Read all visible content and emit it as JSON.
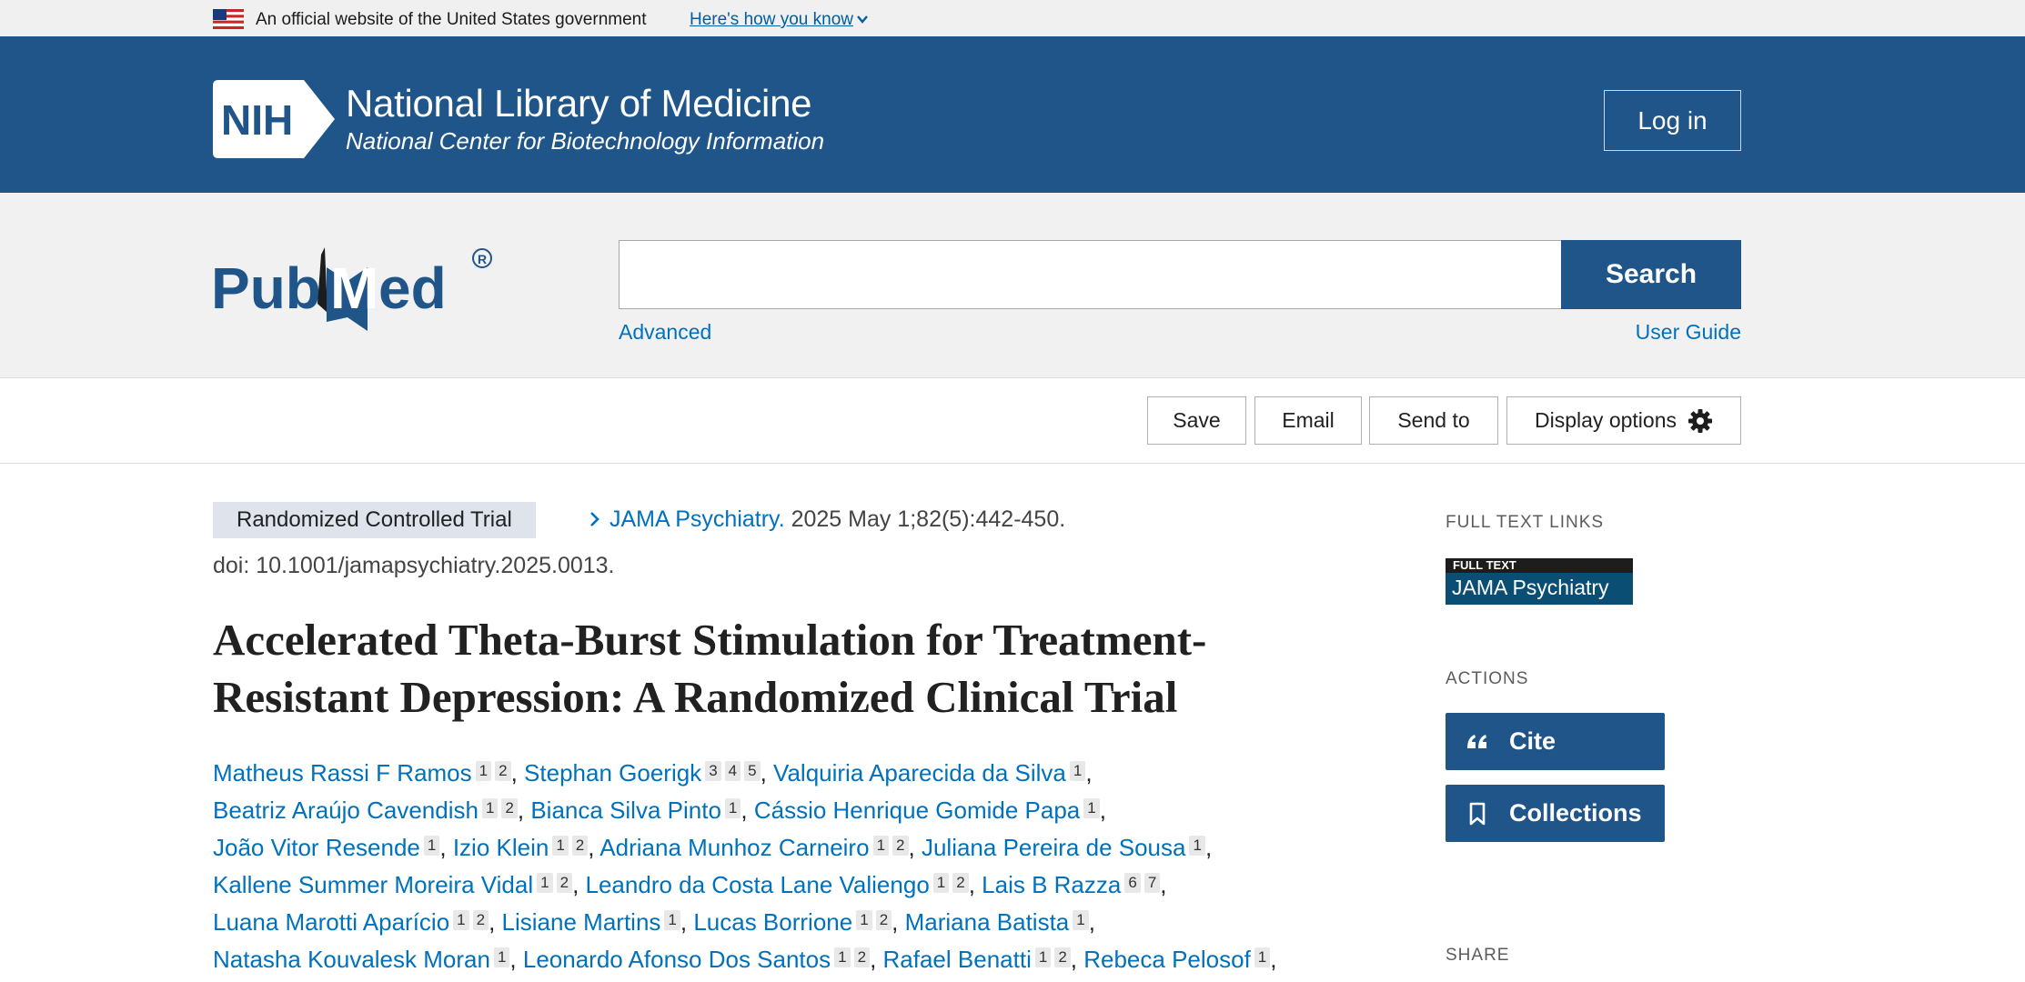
{
  "gov_banner": {
    "text": "An official website of the United States government",
    "link": "Here's how you know"
  },
  "nih": {
    "logo_text": "NIH",
    "title": "National Library of Medicine",
    "subtitle": "National Center for Biotechnology Information",
    "login_label": "Log in"
  },
  "search": {
    "logo_alt": "PubMed",
    "query": "",
    "button_label": "Search",
    "advanced_label": "Advanced",
    "user_guide_label": "User Guide"
  },
  "toolbar": {
    "save": "Save",
    "email": "Email",
    "send_to": "Send to",
    "display_options": "Display options"
  },
  "article": {
    "pub_type": "Randomized Controlled Trial",
    "journal": "JAMA Psychiatry.",
    "citation": " 2025 May 1;82(5):442-450.",
    "doi": "doi: 10.1001/jamapsychiatry.2025.0013.",
    "title": "Accelerated Theta-Burst Stimulation for Treatment-Resistant Depression: A Randomized Clinical Trial",
    "authors": [
      {
        "name": "Matheus Rassi F Ramos",
        "aff": [
          "1",
          "2"
        ]
      },
      {
        "name": "Stephan Goerigk",
        "aff": [
          "3",
          "4",
          "5"
        ]
      },
      {
        "name": "Valquiria Aparecida da Silva",
        "aff": [
          "1"
        ]
      },
      {
        "name": "Beatriz Araújo Cavendish",
        "aff": [
          "1",
          "2"
        ]
      },
      {
        "name": "Bianca Silva Pinto",
        "aff": [
          "1"
        ]
      },
      {
        "name": "Cássio Henrique Gomide Papa",
        "aff": [
          "1"
        ]
      },
      {
        "name": "João Vitor Resende",
        "aff": [
          "1"
        ]
      },
      {
        "name": "Izio Klein",
        "aff": [
          "1",
          "2"
        ]
      },
      {
        "name": "Adriana Munhoz Carneiro",
        "aff": [
          "1",
          "2"
        ]
      },
      {
        "name": "Juliana Pereira de Sousa",
        "aff": [
          "1"
        ]
      },
      {
        "name": "Kallene Summer Moreira Vidal",
        "aff": [
          "1",
          "2"
        ]
      },
      {
        "name": "Leandro da Costa Lane Valiengo",
        "aff": [
          "1",
          "2"
        ]
      },
      {
        "name": "Lais B Razza",
        "aff": [
          "6",
          "7"
        ]
      },
      {
        "name": "Luana Marotti Aparício",
        "aff": [
          "1",
          "2"
        ]
      },
      {
        "name": "Lisiane Martins",
        "aff": [
          "1"
        ]
      },
      {
        "name": "Lucas Borrione",
        "aff": [
          "1",
          "2"
        ]
      },
      {
        "name": "Mariana Batista",
        "aff": [
          "1"
        ]
      },
      {
        "name": "Natasha Kouvalesk Moran",
        "aff": [
          "1"
        ]
      },
      {
        "name": "Leonardo Afonso Dos Santos",
        "aff": [
          "1",
          "2"
        ]
      },
      {
        "name": "Rafael Benatti",
        "aff": [
          "1",
          "2"
        ]
      },
      {
        "name": "Rebeca Pelosof",
        "aff": [
          "1"
        ]
      }
    ],
    "author_lines": [
      [
        0,
        1,
        2
      ],
      [
        3,
        4,
        5
      ],
      [
        6,
        7,
        8,
        9
      ],
      [
        10,
        11,
        12
      ],
      [
        13,
        14,
        15,
        16
      ],
      [
        17,
        18,
        19,
        20
      ]
    ]
  },
  "sidebar": {
    "full_text_links": "FULL TEXT LINKS",
    "badge_top": "FULL TEXT",
    "badge_name": "JAMA Psychiatry",
    "actions": "ACTIONS",
    "cite": "Cite",
    "collections": "Collections",
    "share": "SHARE"
  },
  "colors": {
    "nih_blue": "#20558a",
    "link_blue": "#0071bc",
    "gov_link": "#005ea2"
  },
  "icons": [
    "us-flag-icon",
    "chevron-down-icon",
    "nih-logo",
    "pubmed-logo",
    "gear-icon",
    "chevron-right-icon",
    "quote-icon",
    "bookmark-icon"
  ]
}
